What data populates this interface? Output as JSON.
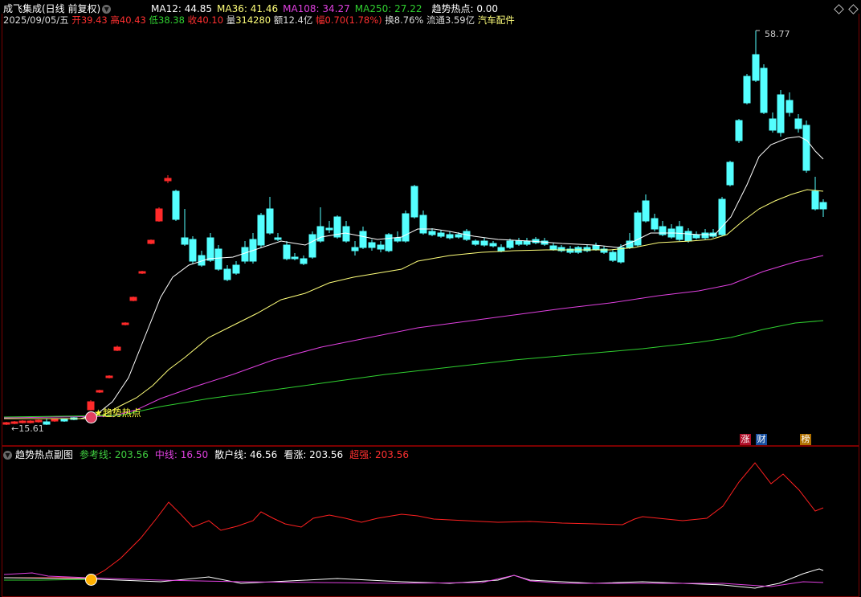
{
  "header": {
    "title": "成飞集成(日线 前复权)",
    "ma12_label": "MA12: 44.85",
    "ma36_label": "MA36: 41.46",
    "ma108_label": "MA108: 34.27",
    "ma250_label": "MA250: 27.22",
    "hot_label": "趋势热点: 0.00"
  },
  "quote": {
    "date": "2025/09/05/五",
    "open_k": "开",
    "open_v": "39.43",
    "high_k": "高",
    "high_v": "40.43",
    "low_k": "低",
    "low_v": "38.38",
    "close_k": "收",
    "close_v": "40.10",
    "vol_k": "量",
    "vol_v": "314280",
    "amount": "额12.4亿",
    "chg_k": "幅",
    "chg_v": "0.70(1.78%)",
    "turnover": "换8.76%",
    "float": "流通3.59亿",
    "sector": "汽车配件"
  },
  "main_chart": {
    "high_marker": "58.77",
    "low_marker": "15.61",
    "signal_label": "★趋势热点",
    "tags": [
      "涨",
      "财",
      "榜"
    ]
  },
  "sub_header": {
    "title": "趋势热点副图",
    "ref_label": "参考线: 203.56",
    "mid_label": "中线: 16.50",
    "retail_label": "散户线: 46.56",
    "bull_label": "看涨: 203.56",
    "strong_label": "超强: 203.56"
  },
  "colors": {
    "up": "#ff2a2a",
    "down": "#54ffff",
    "ma12": "#ffffff",
    "ma36": "#ffff7a",
    "ma108": "#e040e0",
    "ma250": "#30d030",
    "frame": "#7a0000"
  }
}
